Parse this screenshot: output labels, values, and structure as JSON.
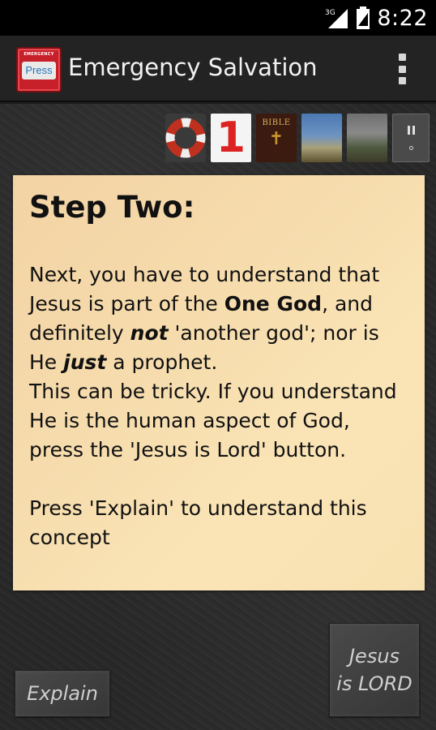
{
  "status_bar": {
    "time": "8:22",
    "network_label": "3G",
    "icons": [
      "signal-icon",
      "battery-icon"
    ]
  },
  "action_bar": {
    "logo_top_text": "EMERGENCY",
    "logo_press_text": "Press",
    "title": "Emergency Salvation",
    "overflow_icon": "overflow-menu-icon"
  },
  "toolbar": {
    "number": "1",
    "bible_label": "BIBLE",
    "bible_cross": "✝"
  },
  "card": {
    "title": "Step Two:",
    "line1_pre": "Next, you have to understand that Jesus is part of the ",
    "line1_bold": "One God",
    "line1_post": ", and definitely ",
    "line2_em": "not",
    "line2_post": " 'another god'; nor is He ",
    "line3_em": "just",
    "line3_post": " a prophet.",
    "para2": "This can be tricky. If you understand He is the human aspect of God, press the 'Jesus is Lord' button.",
    "para3": "Press 'Explain' to understand this concept"
  },
  "buttons": {
    "explain_label": "Explain",
    "lord_line1": "Jesus",
    "lord_line2": "is LORD"
  }
}
